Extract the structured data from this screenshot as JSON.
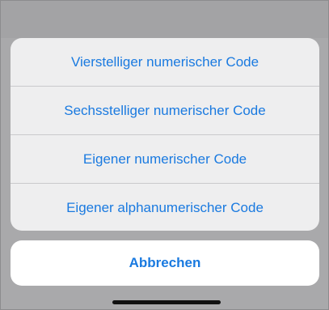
{
  "action_sheet": {
    "options": [
      {
        "label": "Vierstelliger numerischer Code"
      },
      {
        "label": "Sechsstelliger numerischer Code"
      },
      {
        "label": "Eigener numerischer Code"
      },
      {
        "label": "Eigener alphanumerischer Code"
      }
    ],
    "cancel_label": "Abbrechen"
  },
  "colors": {
    "accent": "#1a7ae0",
    "sheet_background": "#eeeeef",
    "dim_background": "#a9a9ab"
  }
}
